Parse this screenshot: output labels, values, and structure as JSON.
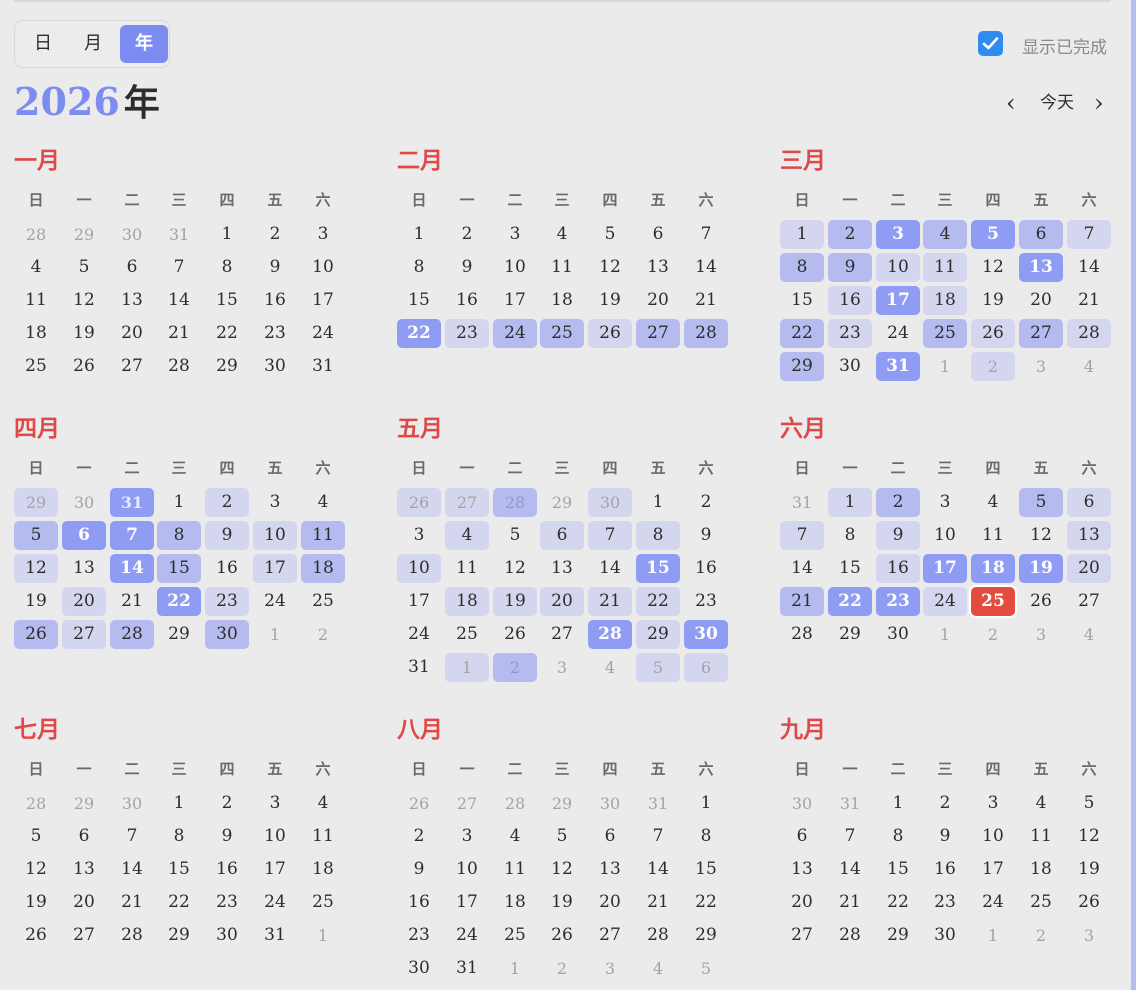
{
  "view_switch": {
    "day_label": "日",
    "month_label": "月",
    "year_label": "年",
    "active": "year"
  },
  "completed_toggle": {
    "checked": true,
    "label": "显示已完成"
  },
  "year_title": {
    "year": "2026",
    "unit": "年"
  },
  "nav": {
    "prev": "‹",
    "today": "今天",
    "next": "›"
  },
  "weekdays": [
    "日",
    "一",
    "二",
    "三",
    "四",
    "五",
    "六"
  ],
  "colors": {
    "accent": "#7c8cf0",
    "month_title": "#e04848",
    "today": "#e34c3d",
    "checkbox": "#2f8bf0",
    "level1": "#d3d6ee",
    "level2": "#b5bbee",
    "level3": "#8f9cf3"
  },
  "legend_note": "",
  "months": [
    {
      "title": "一月",
      "weeks": [
        [
          {
            "d": "28",
            "o": 1
          },
          {
            "d": "29",
            "o": 1
          },
          {
            "d": "30",
            "o": 1
          },
          {
            "d": "31",
            "o": 1
          },
          {
            "d": "1"
          },
          {
            "d": "2"
          },
          {
            "d": "3"
          }
        ],
        [
          {
            "d": "4"
          },
          {
            "d": "5"
          },
          {
            "d": "6"
          },
          {
            "d": "7"
          },
          {
            "d": "8"
          },
          {
            "d": "9"
          },
          {
            "d": "10"
          }
        ],
        [
          {
            "d": "11"
          },
          {
            "d": "12"
          },
          {
            "d": "13"
          },
          {
            "d": "14"
          },
          {
            "d": "15"
          },
          {
            "d": "16"
          },
          {
            "d": "17"
          }
        ],
        [
          {
            "d": "18"
          },
          {
            "d": "19"
          },
          {
            "d": "20"
          },
          {
            "d": "21"
          },
          {
            "d": "22"
          },
          {
            "d": "23"
          },
          {
            "d": "24"
          }
        ],
        [
          {
            "d": "25"
          },
          {
            "d": "26"
          },
          {
            "d": "27"
          },
          {
            "d": "28"
          },
          {
            "d": "29"
          },
          {
            "d": "30"
          },
          {
            "d": "31"
          }
        ]
      ]
    },
    {
      "title": "二月",
      "weeks": [
        [
          {
            "d": "1"
          },
          {
            "d": "2"
          },
          {
            "d": "3"
          },
          {
            "d": "4"
          },
          {
            "d": "5"
          },
          {
            "d": "6"
          },
          {
            "d": "7"
          }
        ],
        [
          {
            "d": "8"
          },
          {
            "d": "9"
          },
          {
            "d": "10"
          },
          {
            "d": "11"
          },
          {
            "d": "12"
          },
          {
            "d": "13"
          },
          {
            "d": "14"
          }
        ],
        [
          {
            "d": "15"
          },
          {
            "d": "16"
          },
          {
            "d": "17"
          },
          {
            "d": "18"
          },
          {
            "d": "19"
          },
          {
            "d": "20"
          },
          {
            "d": "21"
          }
        ],
        [
          {
            "d": "22",
            "l": 3
          },
          {
            "d": "23",
            "l": 1
          },
          {
            "d": "24",
            "l": 2
          },
          {
            "d": "25",
            "l": 2
          },
          {
            "d": "26",
            "l": 1
          },
          {
            "d": "27",
            "l": 2
          },
          {
            "d": "28",
            "l": 2
          }
        ]
      ]
    },
    {
      "title": "三月",
      "weeks": [
        [
          {
            "d": "1",
            "l": 1
          },
          {
            "d": "2",
            "l": 2
          },
          {
            "d": "3",
            "l": 3
          },
          {
            "d": "4",
            "l": 2
          },
          {
            "d": "5",
            "l": 3
          },
          {
            "d": "6",
            "l": 2
          },
          {
            "d": "7",
            "l": 1
          }
        ],
        [
          {
            "d": "8",
            "l": 2
          },
          {
            "d": "9",
            "l": 2
          },
          {
            "d": "10",
            "l": 1
          },
          {
            "d": "11",
            "l": 1
          },
          {
            "d": "12"
          },
          {
            "d": "13",
            "l": 3
          },
          {
            "d": "14"
          }
        ],
        [
          {
            "d": "15"
          },
          {
            "d": "16",
            "l": 1
          },
          {
            "d": "17",
            "l": 3
          },
          {
            "d": "18",
            "l": 1
          },
          {
            "d": "19"
          },
          {
            "d": "20"
          },
          {
            "d": "21"
          }
        ],
        [
          {
            "d": "22",
            "l": 2
          },
          {
            "d": "23",
            "l": 1
          },
          {
            "d": "24"
          },
          {
            "d": "25",
            "l": 2
          },
          {
            "d": "26",
            "l": 1
          },
          {
            "d": "27",
            "l": 2
          },
          {
            "d": "28",
            "l": 1
          }
        ],
        [
          {
            "d": "29",
            "l": 2
          },
          {
            "d": "30"
          },
          {
            "d": "31",
            "l": 3
          },
          {
            "d": "1",
            "o": 1
          },
          {
            "d": "2",
            "o": 1,
            "l": 1
          },
          {
            "d": "3",
            "o": 1
          },
          {
            "d": "4",
            "o": 1
          }
        ]
      ]
    },
    {
      "title": "四月",
      "weeks": [
        [
          {
            "d": "29",
            "o": 1,
            "l": 1
          },
          {
            "d": "30",
            "o": 1
          },
          {
            "d": "31",
            "o": 1,
            "l": 3
          },
          {
            "d": "1"
          },
          {
            "d": "2",
            "l": 1
          },
          {
            "d": "3"
          },
          {
            "d": "4"
          }
        ],
        [
          {
            "d": "5",
            "l": 2
          },
          {
            "d": "6",
            "l": 3
          },
          {
            "d": "7",
            "l": 3
          },
          {
            "d": "8",
            "l": 2
          },
          {
            "d": "9",
            "l": 1
          },
          {
            "d": "10",
            "l": 1
          },
          {
            "d": "11",
            "l": 2
          }
        ],
        [
          {
            "d": "12",
            "l": 1
          },
          {
            "d": "13"
          },
          {
            "d": "14",
            "l": 3
          },
          {
            "d": "15",
            "l": 2
          },
          {
            "d": "16"
          },
          {
            "d": "17",
            "l": 1
          },
          {
            "d": "18",
            "l": 2
          }
        ],
        [
          {
            "d": "19"
          },
          {
            "d": "20",
            "l": 1
          },
          {
            "d": "21"
          },
          {
            "d": "22",
            "l": 3
          },
          {
            "d": "23",
            "l": 1
          },
          {
            "d": "24"
          },
          {
            "d": "25"
          }
        ],
        [
          {
            "d": "26",
            "l": 2
          },
          {
            "d": "27",
            "l": 1
          },
          {
            "d": "28",
            "l": 2
          },
          {
            "d": "29"
          },
          {
            "d": "30",
            "l": 2
          },
          {
            "d": "1",
            "o": 1
          },
          {
            "d": "2",
            "o": 1
          }
        ]
      ]
    },
    {
      "title": "五月",
      "weeks": [
        [
          {
            "d": "26",
            "o": 1,
            "l": 1
          },
          {
            "d": "27",
            "o": 1,
            "l": 1
          },
          {
            "d": "28",
            "o": 1,
            "l": 2
          },
          {
            "d": "29",
            "o": 1
          },
          {
            "d": "30",
            "o": 1,
            "l": 1
          },
          {
            "d": "1"
          },
          {
            "d": "2"
          }
        ],
        [
          {
            "d": "3"
          },
          {
            "d": "4",
            "l": 1
          },
          {
            "d": "5"
          },
          {
            "d": "6",
            "l": 1
          },
          {
            "d": "7",
            "l": 1
          },
          {
            "d": "8",
            "l": 1
          },
          {
            "d": "9"
          }
        ],
        [
          {
            "d": "10",
            "l": 1
          },
          {
            "d": "11"
          },
          {
            "d": "12"
          },
          {
            "d": "13"
          },
          {
            "d": "14"
          },
          {
            "d": "15",
            "l": 3
          },
          {
            "d": "16"
          }
        ],
        [
          {
            "d": "17"
          },
          {
            "d": "18",
            "l": 1
          },
          {
            "d": "19",
            "l": 1
          },
          {
            "d": "20",
            "l": 1
          },
          {
            "d": "21",
            "l": 1
          },
          {
            "d": "22",
            "l": 1
          },
          {
            "d": "23"
          }
        ],
        [
          {
            "d": "24"
          },
          {
            "d": "25"
          },
          {
            "d": "26"
          },
          {
            "d": "27"
          },
          {
            "d": "28",
            "l": 3
          },
          {
            "d": "29",
            "l": 1
          },
          {
            "d": "30",
            "l": 3
          }
        ],
        [
          {
            "d": "31"
          },
          {
            "d": "1",
            "o": 1,
            "l": 1
          },
          {
            "d": "2",
            "o": 1,
            "l": 2
          },
          {
            "d": "3",
            "o": 1
          },
          {
            "d": "4",
            "o": 1
          },
          {
            "d": "5",
            "o": 1,
            "l": 1
          },
          {
            "d": "6",
            "o": 1,
            "l": 1
          }
        ]
      ]
    },
    {
      "title": "六月",
      "weeks": [
        [
          {
            "d": "31",
            "o": 1
          },
          {
            "d": "1",
            "l": 1
          },
          {
            "d": "2",
            "l": 2
          },
          {
            "d": "3"
          },
          {
            "d": "4"
          },
          {
            "d": "5",
            "l": 2
          },
          {
            "d": "6",
            "l": 1
          }
        ],
        [
          {
            "d": "7",
            "l": 1
          },
          {
            "d": "8"
          },
          {
            "d": "9",
            "l": 1
          },
          {
            "d": "10"
          },
          {
            "d": "11"
          },
          {
            "d": "12"
          },
          {
            "d": "13",
            "l": 1
          }
        ],
        [
          {
            "d": "14"
          },
          {
            "d": "15"
          },
          {
            "d": "16",
            "l": 1
          },
          {
            "d": "17",
            "l": 3
          },
          {
            "d": "18",
            "l": 3
          },
          {
            "d": "19",
            "l": 3
          },
          {
            "d": "20",
            "l": 1
          }
        ],
        [
          {
            "d": "21",
            "l": 2
          },
          {
            "d": "22",
            "l": 3
          },
          {
            "d": "23",
            "l": 3
          },
          {
            "d": "24",
            "l": 1
          },
          {
            "d": "25",
            "today": true
          },
          {
            "d": "26"
          },
          {
            "d": "27"
          }
        ],
        [
          {
            "d": "28"
          },
          {
            "d": "29"
          },
          {
            "d": "30"
          },
          {
            "d": "1",
            "o": 1
          },
          {
            "d": "2",
            "o": 1
          },
          {
            "d": "3",
            "o": 1
          },
          {
            "d": "4",
            "o": 1
          }
        ]
      ]
    },
    {
      "title": "七月",
      "weeks": [
        [
          {
            "d": "28",
            "o": 1
          },
          {
            "d": "29",
            "o": 1
          },
          {
            "d": "30",
            "o": 1
          },
          {
            "d": "1"
          },
          {
            "d": "2"
          },
          {
            "d": "3"
          },
          {
            "d": "4"
          }
        ],
        [
          {
            "d": "5"
          },
          {
            "d": "6"
          },
          {
            "d": "7"
          },
          {
            "d": "8"
          },
          {
            "d": "9"
          },
          {
            "d": "10"
          },
          {
            "d": "11"
          }
        ],
        [
          {
            "d": "12"
          },
          {
            "d": "13"
          },
          {
            "d": "14"
          },
          {
            "d": "15"
          },
          {
            "d": "16"
          },
          {
            "d": "17"
          },
          {
            "d": "18"
          }
        ],
        [
          {
            "d": "19"
          },
          {
            "d": "20"
          },
          {
            "d": "21"
          },
          {
            "d": "22"
          },
          {
            "d": "23"
          },
          {
            "d": "24"
          },
          {
            "d": "25"
          }
        ],
        [
          {
            "d": "26"
          },
          {
            "d": "27"
          },
          {
            "d": "28"
          },
          {
            "d": "29"
          },
          {
            "d": "30"
          },
          {
            "d": "31"
          },
          {
            "d": "1",
            "o": 1
          }
        ]
      ]
    },
    {
      "title": "八月",
      "weeks": [
        [
          {
            "d": "26",
            "o": 1
          },
          {
            "d": "27",
            "o": 1
          },
          {
            "d": "28",
            "o": 1
          },
          {
            "d": "29",
            "o": 1
          },
          {
            "d": "30",
            "o": 1
          },
          {
            "d": "31",
            "o": 1
          },
          {
            "d": "1"
          }
        ],
        [
          {
            "d": "2"
          },
          {
            "d": "3"
          },
          {
            "d": "4"
          },
          {
            "d": "5"
          },
          {
            "d": "6"
          },
          {
            "d": "7"
          },
          {
            "d": "8"
          }
        ],
        [
          {
            "d": "9"
          },
          {
            "d": "10"
          },
          {
            "d": "11"
          },
          {
            "d": "12"
          },
          {
            "d": "13"
          },
          {
            "d": "14"
          },
          {
            "d": "15"
          }
        ],
        [
          {
            "d": "16"
          },
          {
            "d": "17"
          },
          {
            "d": "18"
          },
          {
            "d": "19"
          },
          {
            "d": "20"
          },
          {
            "d": "21"
          },
          {
            "d": "22"
          }
        ],
        [
          {
            "d": "23"
          },
          {
            "d": "24"
          },
          {
            "d": "25"
          },
          {
            "d": "26"
          },
          {
            "d": "27"
          },
          {
            "d": "28"
          },
          {
            "d": "29"
          }
        ],
        [
          {
            "d": "30"
          },
          {
            "d": "31"
          },
          {
            "d": "1",
            "o": 1
          },
          {
            "d": "2",
            "o": 1
          },
          {
            "d": "3",
            "o": 1
          },
          {
            "d": "4",
            "o": 1
          },
          {
            "d": "5",
            "o": 1
          }
        ]
      ]
    },
    {
      "title": "九月",
      "weeks": [
        [
          {
            "d": "30",
            "o": 1
          },
          {
            "d": "31",
            "o": 1
          },
          {
            "d": "1"
          },
          {
            "d": "2"
          },
          {
            "d": "3"
          },
          {
            "d": "4"
          },
          {
            "d": "5"
          }
        ],
        [
          {
            "d": "6"
          },
          {
            "d": "7"
          },
          {
            "d": "8"
          },
          {
            "d": "9"
          },
          {
            "d": "10"
          },
          {
            "d": "11"
          },
          {
            "d": "12"
          }
        ],
        [
          {
            "d": "13"
          },
          {
            "d": "14"
          },
          {
            "d": "15"
          },
          {
            "d": "16"
          },
          {
            "d": "17"
          },
          {
            "d": "18"
          },
          {
            "d": "19"
          }
        ],
        [
          {
            "d": "20"
          },
          {
            "d": "21"
          },
          {
            "d": "22"
          },
          {
            "d": "23"
          },
          {
            "d": "24"
          },
          {
            "d": "25"
          },
          {
            "d": "26"
          }
        ],
        [
          {
            "d": "27"
          },
          {
            "d": "28"
          },
          {
            "d": "29"
          },
          {
            "d": "30"
          },
          {
            "d": "1",
            "o": 1
          },
          {
            "d": "2",
            "o": 1
          },
          {
            "d": "3",
            "o": 1
          }
        ]
      ]
    }
  ]
}
